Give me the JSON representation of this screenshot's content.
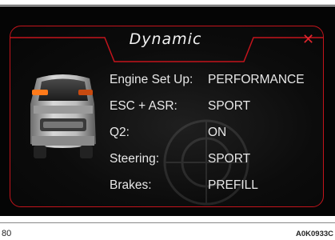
{
  "panel": {
    "title": "Dynamic",
    "close_icon": "close-x-icon",
    "accent_color": "#c3141c"
  },
  "settings": [
    {
      "label": "Engine Set Up:",
      "value": "PERFORMANCE"
    },
    {
      "label": "ESC + ASR:",
      "value": "SPORT"
    },
    {
      "label": "Q2:",
      "value": "ON"
    },
    {
      "label": "Steering:",
      "value": "SPORT"
    },
    {
      "label": "Brakes:",
      "value": "PREFILL"
    }
  ],
  "footer": {
    "page_number": "80",
    "figure_code": "A0K0933C"
  }
}
